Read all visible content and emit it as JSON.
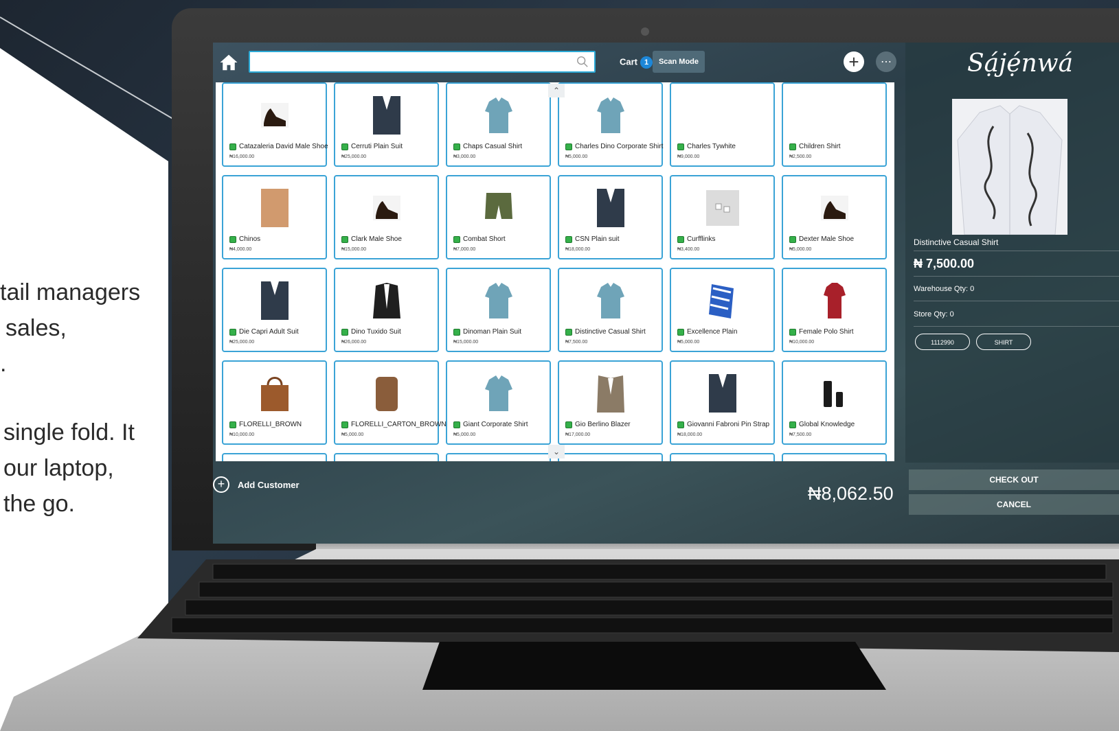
{
  "promo": {
    "line1": "tail managers",
    "line2": "sales,",
    "line3": ".",
    "line4": "single fold. It",
    "line5": "our laptop,",
    "line6": "the go."
  },
  "topbar": {
    "search_value": "",
    "cart_label": "Cart",
    "cart_count": "1",
    "scan_mode_label": "Scan Mode"
  },
  "products": [
    {
      "name": "Catazaleria David Male Shoe",
      "price": "₦16,000.00",
      "icon": "shoe-icon"
    },
    {
      "name": "Cerruti Plain Suit",
      "price": "₦25,000.00",
      "icon": "suit-icon"
    },
    {
      "name": "Chaps Casual Shirt",
      "price": "₦3,000.00",
      "icon": "shirt-icon"
    },
    {
      "name": "Charles Dino Corporate Shirt",
      "price": "₦5,000.00",
      "icon": "shirt-icon"
    },
    {
      "name": "Charles Tywhite",
      "price": "₦9,000.00",
      "icon": ""
    },
    {
      "name": "Children Shirt",
      "price": "₦2,500.00",
      "icon": ""
    },
    {
      "name": "Chinos",
      "price": "₦4,000.00",
      "icon": "trousers-icon"
    },
    {
      "name": "Clark Male Shoe",
      "price": "₦15,000.00",
      "icon": "shoe-icon"
    },
    {
      "name": "Combat Short",
      "price": "₦7,000.00",
      "icon": "shorts-icon"
    },
    {
      "name": "CSN Plain suit",
      "price": "₦18,000.00",
      "icon": "suit-icon"
    },
    {
      "name": "Curfflinks",
      "price": "₦3,400.00",
      "icon": "cufflinks-icon"
    },
    {
      "name": "Dexter Male Shoe",
      "price": "₦5,000.00",
      "icon": "shoe-icon"
    },
    {
      "name": "Die Capri Adult Suit",
      "price": "₦25,000.00",
      "icon": "suit-icon"
    },
    {
      "name": "Dino Tuxido Suit",
      "price": "₦26,000.00",
      "icon": "tuxedo-icon"
    },
    {
      "name": "Dinoman Plain  Suit",
      "price": "₦15,000.00",
      "icon": "shirt-icon"
    },
    {
      "name": "Distinctive Casual Shirt",
      "price": "₦7,500.00",
      "icon": "shirt-icon"
    },
    {
      "name": "Excellence Plain",
      "price": "₦5,000.00",
      "icon": "fabric-icon"
    },
    {
      "name": "Female Polo Shirt",
      "price": "₦10,000.00",
      "icon": "polo-icon"
    },
    {
      "name": "FLORELLI_BROWN",
      "price": "₦10,000.00",
      "icon": "bag-icon"
    },
    {
      "name": "FLORELLI_CARTON_BROWN",
      "price": "₦5,000.00",
      "icon": "backpack-icon"
    },
    {
      "name": "Giant Corporate Shirt",
      "price": "₦5,000.00",
      "icon": "shirt-icon"
    },
    {
      "name": "Gio Berlino Blazer",
      "price": "₦17,000.00",
      "icon": "blazer-icon"
    },
    {
      "name": "Giovanni Fabroni Pin Strap",
      "price": "₦18,000.00",
      "icon": "suit-icon"
    },
    {
      "name": "Global Knowledge",
      "price": "₦7,500.00",
      "icon": "device-icon"
    }
  ],
  "bottombar": {
    "add_customer_label": "Add Customer",
    "total": "₦8,062.50"
  },
  "detail": {
    "brand": "Sạ́jẹ́nwá",
    "name": "Distinctive Casual Shirt",
    "price": "₦ 7,500.00",
    "warehouse_qty": "Warehouse Qty: 0",
    "store_qty": "Store Qty: 0",
    "tag_code": "1112990",
    "tag_category": "SHIRT"
  },
  "actions": {
    "checkout_label": "CHECK OUT",
    "cancel_label": "CANCEL"
  },
  "colors": {
    "accent": "#3aa3d6",
    "badge": "#1d87d8",
    "stock_dot": "#35b04a"
  }
}
